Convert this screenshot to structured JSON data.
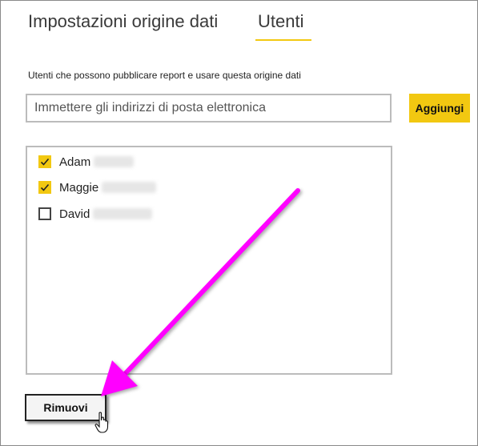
{
  "tabs": {
    "settings_label": "Impostazioni origine dati",
    "users_label": "Utenti",
    "active": "users"
  },
  "caption": "Utenti che possono pubblicare report e usare questa origine dati",
  "email": {
    "placeholder": "Immettere gli indirizzi di posta elettronica",
    "value": ""
  },
  "add_button_label": "Aggiungi",
  "users": [
    {
      "first_name": "Adam",
      "checked": true
    },
    {
      "first_name": "Maggie",
      "checked": true
    },
    {
      "first_name": "David",
      "checked": false
    }
  ],
  "remove_button_label": "Rimuovi",
  "colors": {
    "accent": "#f2c811",
    "annotation_arrow": "#ff00ff"
  }
}
